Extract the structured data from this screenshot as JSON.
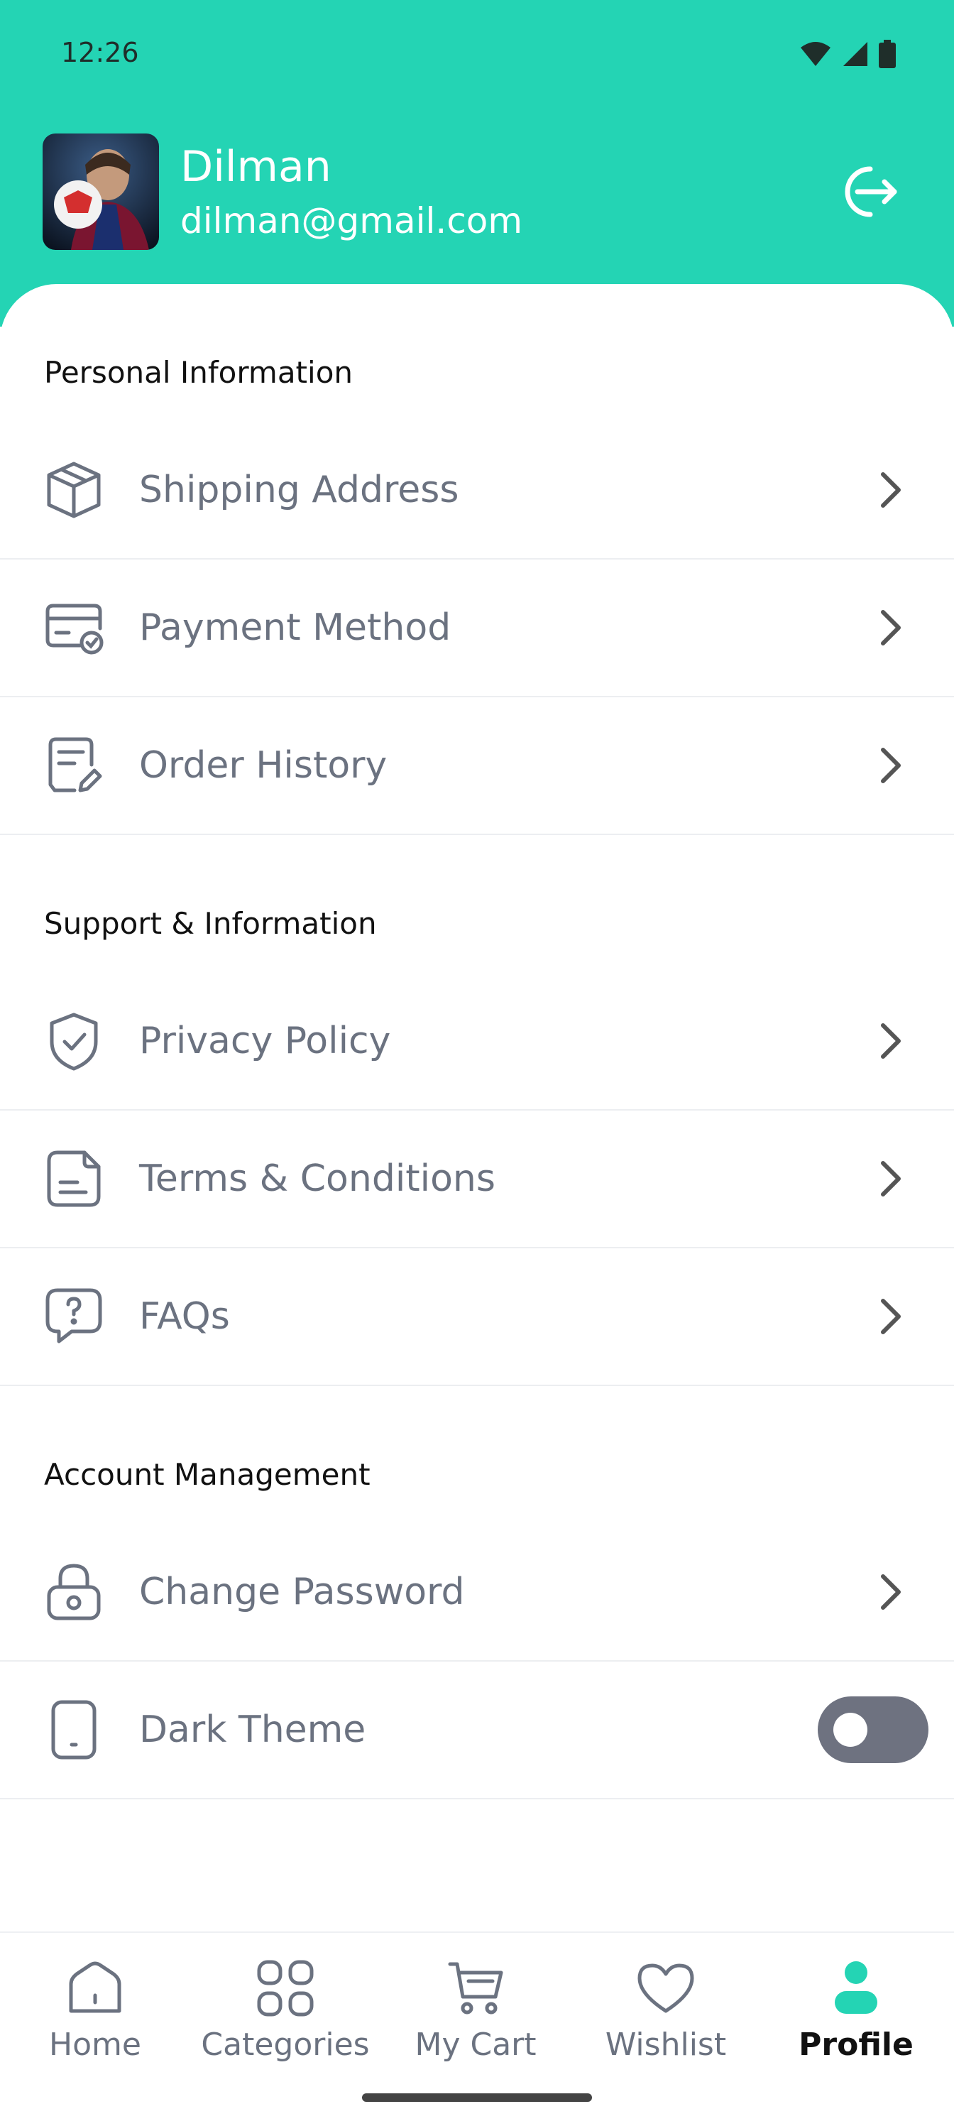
{
  "status_bar": {
    "time": "12:26"
  },
  "profile": {
    "name": "Dilman",
    "email": "dilman@gmail.com"
  },
  "sections": {
    "personal": {
      "title": "Personal Information",
      "items": [
        {
          "label": "Shipping Address",
          "icon": "package-icon"
        },
        {
          "label": "Payment Method",
          "icon": "card-check-icon"
        },
        {
          "label": "Order History",
          "icon": "receipt-edit-icon"
        }
      ]
    },
    "support": {
      "title": "Support & Information",
      "items": [
        {
          "label": "Privacy Policy",
          "icon": "shield-check-icon"
        },
        {
          "label": "Terms & Conditions",
          "icon": "document-icon"
        },
        {
          "label": "FAQs",
          "icon": "question-bubble-icon"
        }
      ]
    },
    "account": {
      "title": "Account Management",
      "items": [
        {
          "label": "Change Password",
          "icon": "lock-icon"
        },
        {
          "label": "Dark Theme",
          "icon": "phone-icon",
          "toggle_on": false
        }
      ]
    }
  },
  "bottom_nav": [
    {
      "label": "Home",
      "icon": "home-icon"
    },
    {
      "label": "Categories",
      "icon": "grid-icon"
    },
    {
      "label": "My Cart",
      "icon": "cart-icon"
    },
    {
      "label": "Wishlist",
      "icon": "heart-icon"
    },
    {
      "label": "Profile",
      "icon": "person-icon",
      "active": true
    }
  ],
  "colors": {
    "accent": "#24D4B4",
    "text_muted": "#6B7280",
    "toggle_off": "#6E7280"
  }
}
